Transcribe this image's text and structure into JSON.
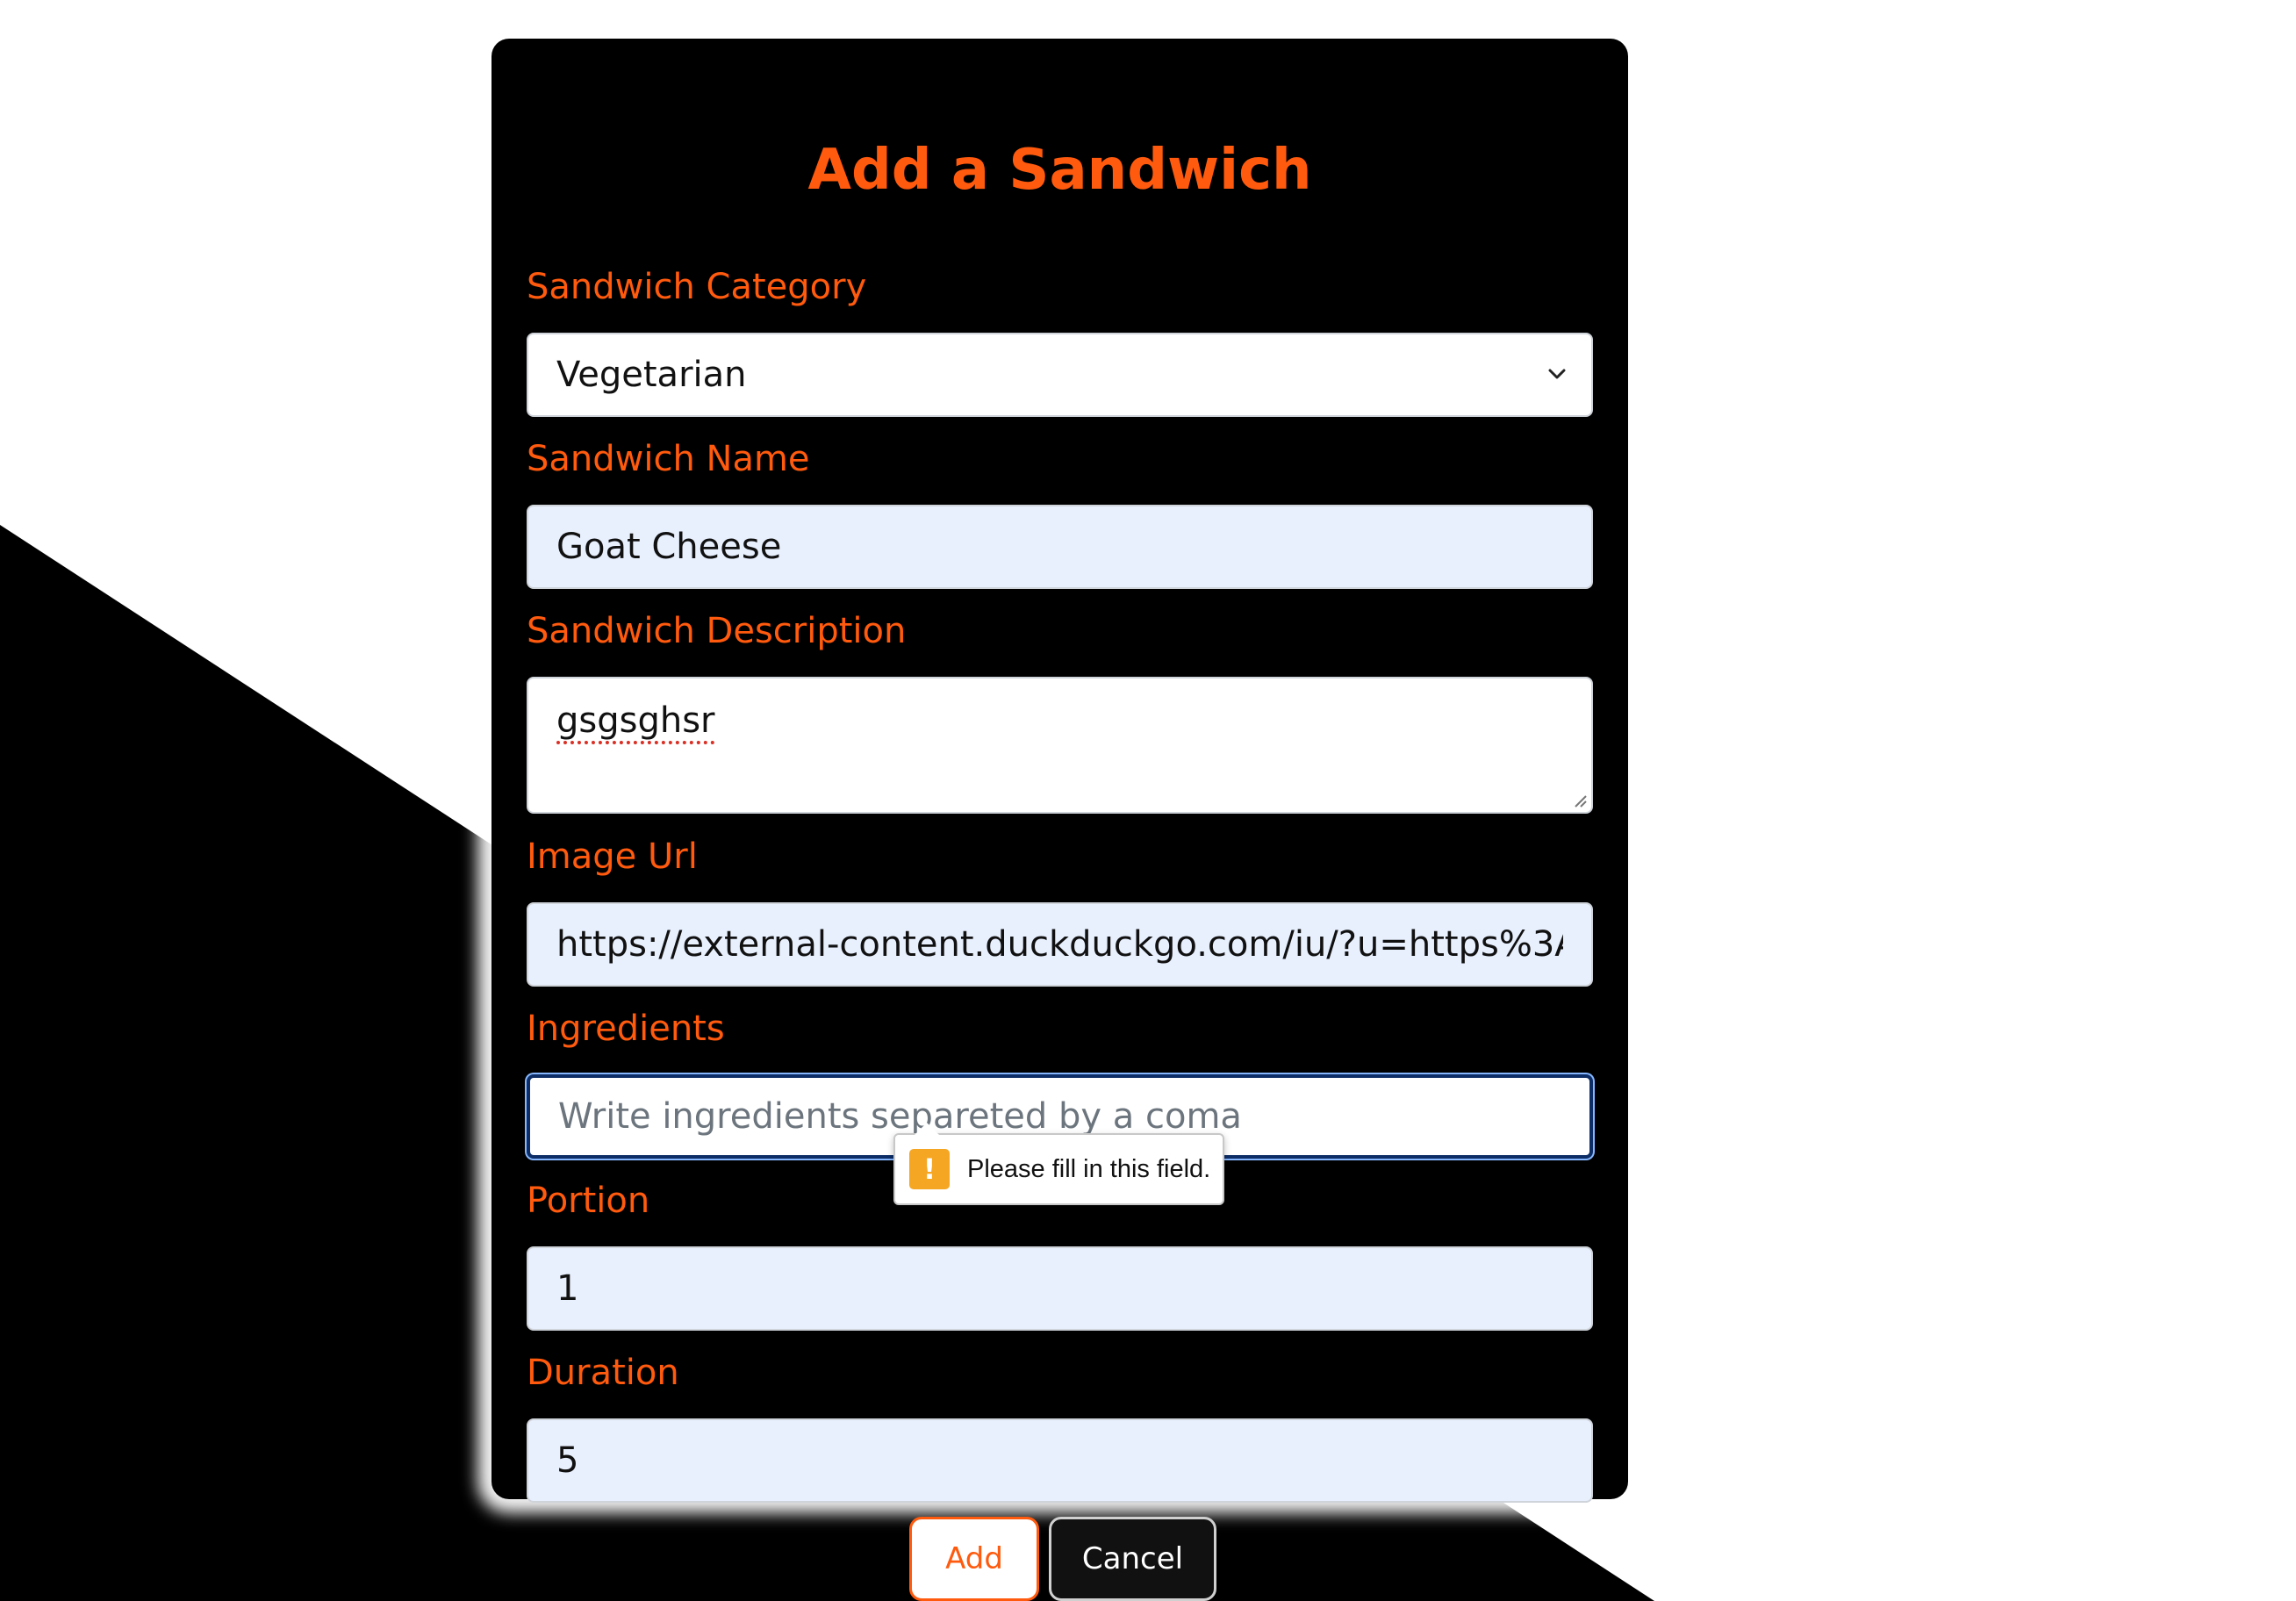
{
  "form": {
    "title": "Add a Sandwich",
    "category": {
      "label": "Sandwich Category",
      "selected": "Vegetarian",
      "options": [
        "Vegetarian"
      ]
    },
    "name": {
      "label": "Sandwich Name",
      "value": "Goat Cheese"
    },
    "description": {
      "label": "Sandwich Description",
      "value": "gsgsghsr"
    },
    "image_url": {
      "label": "Image Url",
      "value": "https://external-content.duckduckgo.com/iu/?u=https%3A"
    },
    "ingredients": {
      "label": "Ingredients",
      "value": "",
      "placeholder": "Write ingredients separeted by a coma"
    },
    "portion": {
      "label": "Portion",
      "value": "1"
    },
    "duration": {
      "label": "Duration",
      "value": "5"
    }
  },
  "validation": {
    "message": "Please fill in this field.",
    "icon": "warning-icon",
    "icon_glyph": "!"
  },
  "actions": {
    "add_label": "Add",
    "cancel_label": "Cancel"
  },
  "colors": {
    "accent": "#ff5a0d",
    "card_background": "#000000",
    "autofill_background": "#e8f0fe",
    "warning": "#f5a623"
  }
}
